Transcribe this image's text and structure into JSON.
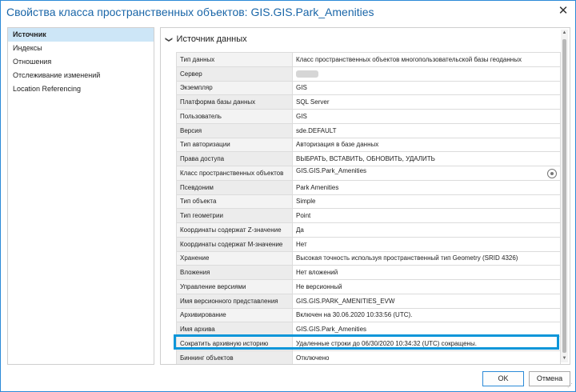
{
  "window": {
    "title": "Свойства класса пространственных объектов: GIS.GIS.Park_Amenities",
    "close_glyph": "✕"
  },
  "sidebar": {
    "items": [
      {
        "label": "Источник",
        "active": true
      },
      {
        "label": "Индексы",
        "active": false
      },
      {
        "label": "Отношения",
        "active": false
      },
      {
        "label": "Отслеживание изменений",
        "active": false
      },
      {
        "label": "Location Referencing",
        "active": false
      }
    ]
  },
  "section": {
    "title": "Источник данных",
    "chevron": "❯"
  },
  "properties": [
    {
      "key": "Тип данных",
      "value": "Класс пространственных объектов многопользовательской базы геоданных"
    },
    {
      "key": "Сервер",
      "value": ""
    },
    {
      "key": "Экземпляр",
      "value": "GIS"
    },
    {
      "key": "Платформа базы данных",
      "value": "SQL Server"
    },
    {
      "key": "Пользователь",
      "value": "GIS"
    },
    {
      "key": "Версия",
      "value": "sde.DEFAULT"
    },
    {
      "key": "Тип авторизации",
      "value": "Авторизация в базе данных"
    },
    {
      "key": "Права доступа",
      "value": "ВЫБРАТЬ, ВСТАВИТЬ, ОБНОВИТЬ, УДАЛИТЬ"
    },
    {
      "key": "Класс пространственных объектов",
      "value": "GIS.GIS.Park_Amenities"
    },
    {
      "key": "Псевдоним",
      "value": "Park Amenities"
    },
    {
      "key": "Тип объекта",
      "value": "Simple"
    },
    {
      "key": "Тип геометрии",
      "value": "Point"
    },
    {
      "key": "Координаты содержат Z-значение",
      "value": "Да"
    },
    {
      "key": "Координаты содержат M-значение",
      "value": "Нет"
    },
    {
      "key": "Хранение",
      "value": "Высокая точность используя пространственный тип Geometry (SRID 4326)"
    },
    {
      "key": "Вложения",
      "value": "Нет вложений"
    },
    {
      "key": "Управление версиями",
      "value": "Не версионный"
    },
    {
      "key": "Имя версионного представления",
      "value": "GIS.GIS.PARK_AMENITIES_EVW"
    },
    {
      "key": "Архивирование",
      "value": "Включен на 30.06.2020 10:33:56 (UTC)."
    },
    {
      "key": "Имя архива",
      "value": "GIS.GIS.Park_Amenities"
    },
    {
      "key": "Сократить архивную историю",
      "value": "Удаленные строки до 06/30/2020 10:34:32  (UTC) сокращены."
    },
    {
      "key": "Биннинг объектов",
      "value": "Отключено"
    }
  ],
  "buttons": {
    "ok_label": "OK",
    "cancel_label": "Отмена"
  },
  "icons": {
    "copy_icon": "copy-icon",
    "accent_color": "#0d96d9",
    "title_color": "#1a66a8"
  }
}
